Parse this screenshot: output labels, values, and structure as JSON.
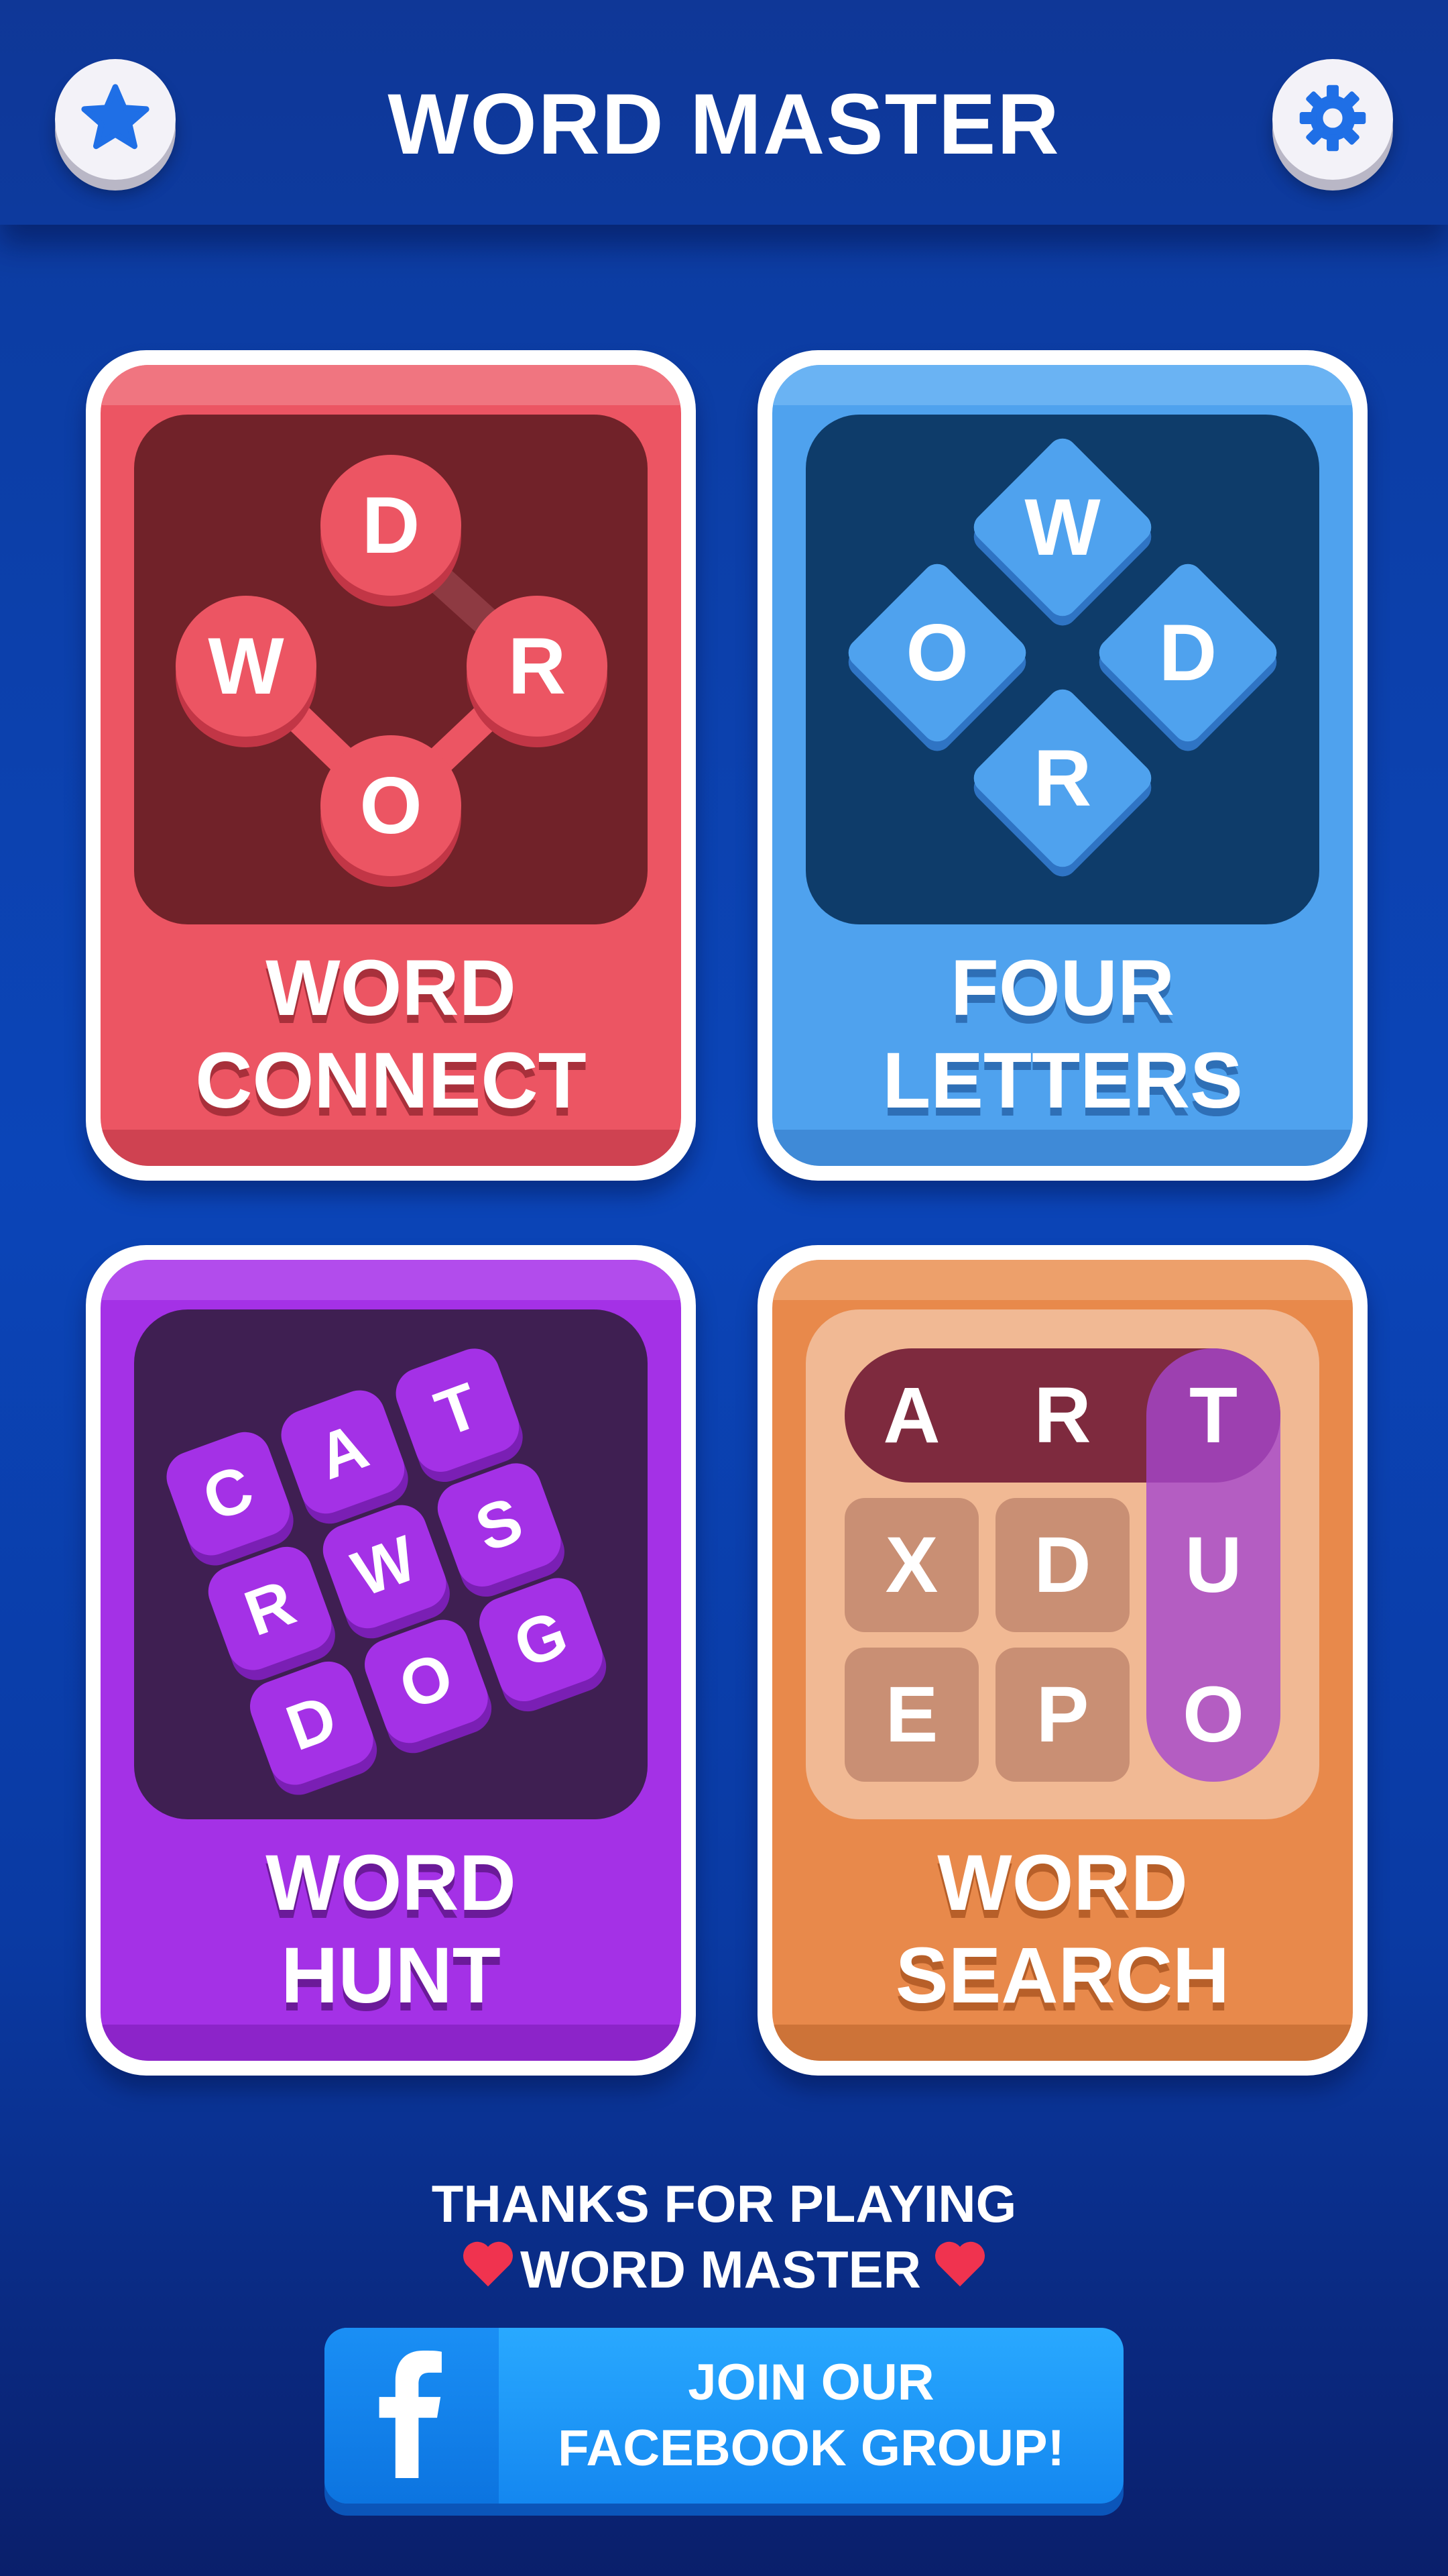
{
  "header": {
    "title": "WORD MASTER",
    "left_button_icon": "star-icon",
    "right_button_icon": "gear-icon"
  },
  "cards": [
    {
      "label_line1": "WORD",
      "label_line2": "CONNECT",
      "color": "#ec5563",
      "tiles": [
        "D",
        "W",
        "R",
        "O"
      ]
    },
    {
      "label_line1": "FOUR",
      "label_line2": "LETTERS",
      "color": "#4fa2ee",
      "tiles": [
        "W",
        "O",
        "D",
        "R"
      ]
    },
    {
      "label_line1": "WORD",
      "label_line2": "HUNT",
      "color": "#a431e6",
      "tiles": [
        "C",
        "A",
        "T",
        "R",
        "W",
        "S",
        "D",
        "O",
        "G"
      ]
    },
    {
      "label_line1": "WORD",
      "label_line2": "SEARCH",
      "color": "#e8894b",
      "grid": [
        "A",
        "R",
        "T",
        "X",
        "D",
        "U",
        "E",
        "P",
        "O"
      ]
    }
  ],
  "footer": {
    "line1": "THANKS FOR PLAYING",
    "line2": "WORD MASTER",
    "heart_color": "#f0334f"
  },
  "facebook": {
    "line1": "JOIN OUR",
    "line2": "FACEBOOK GROUP!",
    "icon": "facebook-icon"
  }
}
